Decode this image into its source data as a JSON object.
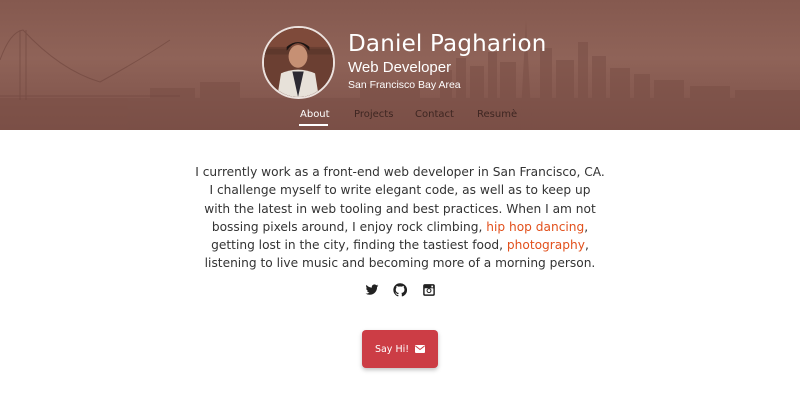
{
  "header": {
    "name": "Daniel Pagharion",
    "role": "Web Developer",
    "location": "San Francisco Bay Area",
    "background_color": "#85594f",
    "avatar_icon": "profile-photo"
  },
  "nav": {
    "items": [
      {
        "label": "About",
        "active": true
      },
      {
        "label": "Projects",
        "active": false
      },
      {
        "label": "Contact",
        "active": false
      },
      {
        "label": "Resumè",
        "active": false
      }
    ]
  },
  "bio": {
    "text_1": "I currently work as a front-end web developer in San Francisco, CA. I challenge myself to write elegant code, as well as to keep up with the latest in web tooling and best practices. When I am not bossing pixels around, I enjoy rock climbing, ",
    "link_1": "hip hop dancing",
    "text_2": ", getting lost in the city, finding the tastiest food, ",
    "link_2": "photography",
    "text_3": ", listening to live music and becoming more of a morning person.",
    "link_color": "#e2501c"
  },
  "socials": [
    {
      "icon": "twitter-icon"
    },
    {
      "icon": "github-icon"
    },
    {
      "icon": "instagram-icon"
    }
  ],
  "cta": {
    "label": "Say Hi!",
    "icon": "envelope-icon",
    "color": "#cc3d45"
  }
}
